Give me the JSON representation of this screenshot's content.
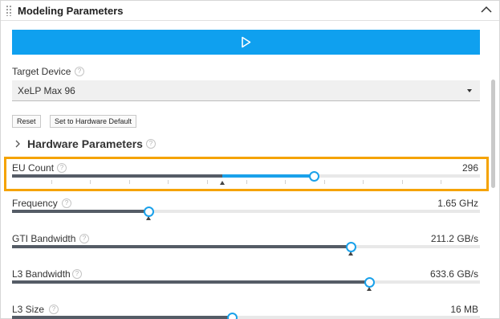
{
  "panel": {
    "title": "Modeling Parameters",
    "icons": {
      "drag": "drag-handle-icon",
      "collapse": "chevron-up-icon"
    }
  },
  "run": {
    "icon": "play-icon",
    "color": "#0fa0ef"
  },
  "target_device": {
    "label": "Target Device",
    "help": "?",
    "selected": "XeLP Max 96"
  },
  "buttons": {
    "reset": "Reset",
    "hardware_default": "Set to Hardware Default"
  },
  "section": {
    "title": "Hardware Parameters",
    "help": "?"
  },
  "accent_colors": {
    "highlight": "#f5a300",
    "slider_active": "#1aa1ea",
    "slider_default": "#555c66"
  },
  "params": [
    {
      "label": "EU Count",
      "help": "?",
      "value": "296",
      "fraction": 0.645,
      "default_fraction": 0.449,
      "highlighted": true
    },
    {
      "label": "Frequency",
      "help": "?",
      "value": "1.65 GHz",
      "fraction": 0.291,
      "default_fraction": 0.291,
      "highlighted": false
    },
    {
      "label": "GTI Bandwidth",
      "help": "?",
      "value": "211.2 GB/s",
      "fraction": 0.724,
      "default_fraction": 0.724,
      "highlighted": false
    },
    {
      "label": "L3 Bandwidth",
      "help": "?",
      "value": "633.6 GB/s",
      "fraction": 0.764,
      "default_fraction": 0.764,
      "highlighted": false
    },
    {
      "label": "L3 Size",
      "help": "?",
      "value": "16 MB",
      "fraction": 0.47,
      "default_fraction": 0.47,
      "highlighted": false
    }
  ]
}
